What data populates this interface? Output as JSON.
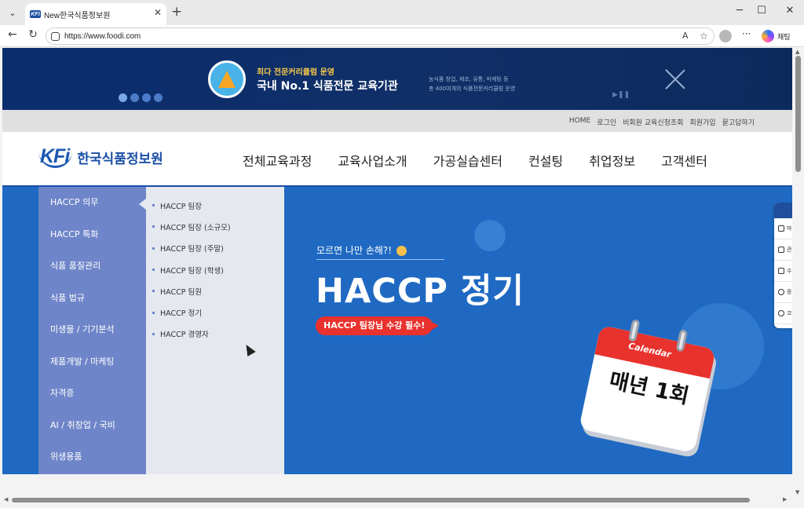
{
  "browser": {
    "tab_title": "New한국식품정보원",
    "tab_favicon_label": "KFI",
    "url": "https://www.foodi.com",
    "chat_label": "채팅",
    "reader_label": "A"
  },
  "top_banner": {
    "subtitle": "최다 전문커리큘럼 운영",
    "title": "국내 No.1 식품전문 교육기관",
    "desc_line1": "농식품 창업, 제조, 유통, 마케팅 등",
    "desc_line2": "총 400여개의 식품전문커리큘럼 운영",
    "play_label": "▶❚❚"
  },
  "utility_links": [
    "HOME",
    "로그인",
    "비회원 교육신청조회",
    "회원가입",
    "묻고답하기"
  ],
  "header": {
    "logo_mark": "KFi",
    "logo_text": "한국식품정보원",
    "gnb": [
      "전체교육과정",
      "교육사업소개",
      "가공실습센터",
      "컨설팅",
      "취업정보",
      "고객센터"
    ]
  },
  "lnb": [
    "HACCP 의무",
    "HACCP 특화",
    "식품 품질관리",
    "식품 법규",
    "미생물 / 기기분석",
    "제품개발 / 마케팅",
    "자격증",
    "AI / 취창업 / 국비",
    "위생용품"
  ],
  "submenu": [
    "HACCP 팀장",
    "HACCP 팀장 (소규모)",
    "HACCP 팀장 (주말)",
    "HACCP 팀장 (학생)",
    "HACCP 팀원",
    "HACCP 정기",
    "HACCP 경영자"
  ],
  "hero": {
    "subtitle": "모르면 나만 손해?!",
    "title": "HACCP 정기",
    "pill": "HACCP 팀장님 수강 필수!",
    "calendar_label": "Calendar",
    "calendar_text": "매년 1회"
  },
  "quick_panel": [
    "마",
    "관",
    "수",
    "증",
    "코"
  ],
  "colors": {
    "accent": "#1f69c2",
    "lnb": "#6f85c9",
    "pill": "#e9312d",
    "banner": "#0b2e6e"
  }
}
